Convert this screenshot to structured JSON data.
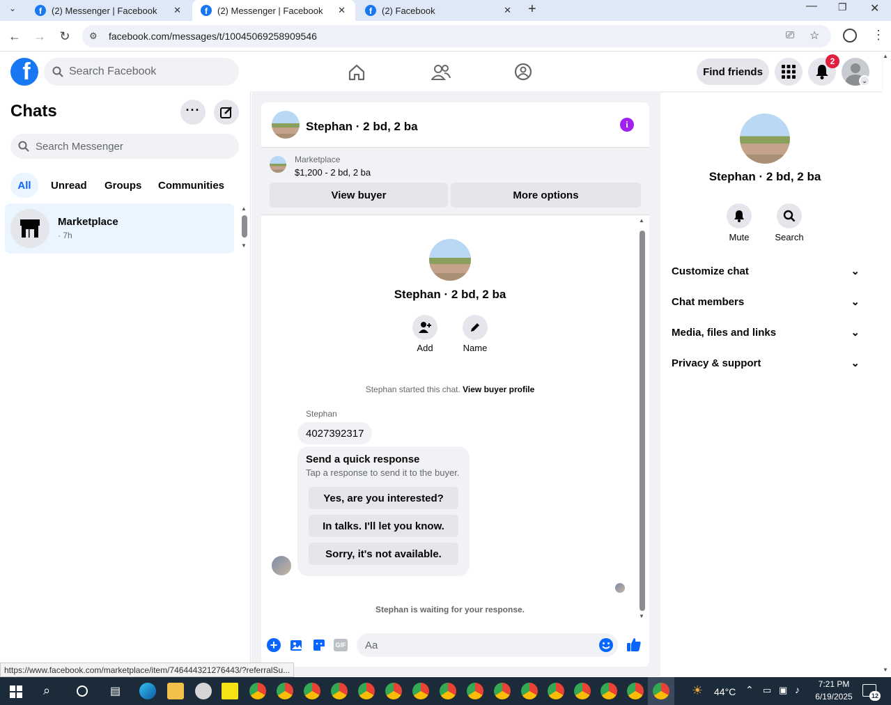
{
  "browser": {
    "tabs": [
      {
        "title": "(2) Messenger | Facebook",
        "active": false
      },
      {
        "title": "(2) Messenger | Facebook",
        "active": true
      },
      {
        "title": "(2) Facebook",
        "active": false
      }
    ],
    "url": "facebook.com/messages/t/10045069258909546",
    "status_url": "https://www.facebook.com/marketplace/item/746444321276443/?referralSu..."
  },
  "header": {
    "search_placeholder": "Search Facebook",
    "find_friends": "Find friends",
    "notification_count": "2"
  },
  "sidebar": {
    "title": "Chats",
    "search_placeholder": "Search Messenger",
    "filters": [
      "All",
      "Unread",
      "Groups",
      "Communities"
    ],
    "chats": [
      {
        "name": "Marketplace",
        "time": "· 7h"
      }
    ]
  },
  "conversation": {
    "title": "Stephan · 2 bd, 2 ba",
    "listing_source": "Marketplace",
    "listing_detail": "$1,200 - 2 bd, 2 ba",
    "view_buyer": "View buyer",
    "more_options": "More options",
    "profile_name": "Stephan · 2 bd, 2 ba",
    "add_label": "Add",
    "name_label": "Name",
    "started_text": "Stephan started this chat.",
    "view_buyer_profile": "View buyer profile",
    "sender": "Stephan",
    "message": "4027392317",
    "quick_title": "Send a quick response",
    "quick_sub": "Tap a response to send it to the buyer.",
    "quick_responses": [
      "Yes, are you interested?",
      "In talks. I'll let you know.",
      "Sorry, it's not available."
    ],
    "waiting_text": "Stephan is waiting for your response.",
    "composer_placeholder": "Aa"
  },
  "details": {
    "name": "Stephan · 2 bd, 2 ba",
    "mute": "Mute",
    "search": "Search",
    "sections": [
      "Customize chat",
      "Chat members",
      "Media, files and links",
      "Privacy & support"
    ]
  },
  "taskbar": {
    "weather": "44°C",
    "time": "7:21 PM",
    "date": "6/19/2025",
    "notif_count": "12"
  },
  "colors": {
    "brand": "#1877f2",
    "accent": "#0866ff",
    "badge": "#e41e3f"
  }
}
